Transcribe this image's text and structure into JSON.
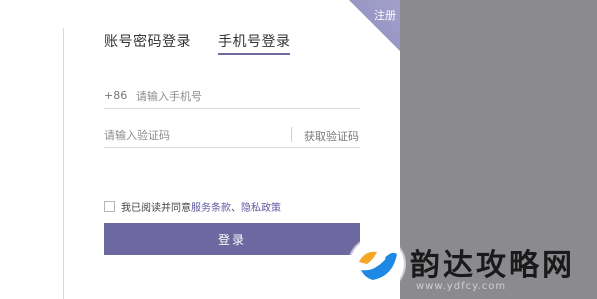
{
  "corner": {
    "label": "注册"
  },
  "tabs": [
    {
      "label": "账号密码登录",
      "active": false
    },
    {
      "label": "手机号登录",
      "active": true
    }
  ],
  "phone": {
    "prefix": "+86",
    "placeholder": "请输入手机号",
    "value": ""
  },
  "code": {
    "placeholder": "请输入验证码",
    "value": "",
    "get_code_label": "获取验证码"
  },
  "agreement": {
    "prefix": "我已阅读并同意",
    "terms_label": "服务条款",
    "separator": "、",
    "privacy_label": "隐私政策"
  },
  "login_button": {
    "label": "登录"
  },
  "watermark": {
    "title": "韵达攻略网",
    "url": "www.ydfcy.com"
  },
  "colors": {
    "accent": "#6d68a0",
    "link": "#5f5aa2",
    "panel": "#8b8b8f"
  }
}
